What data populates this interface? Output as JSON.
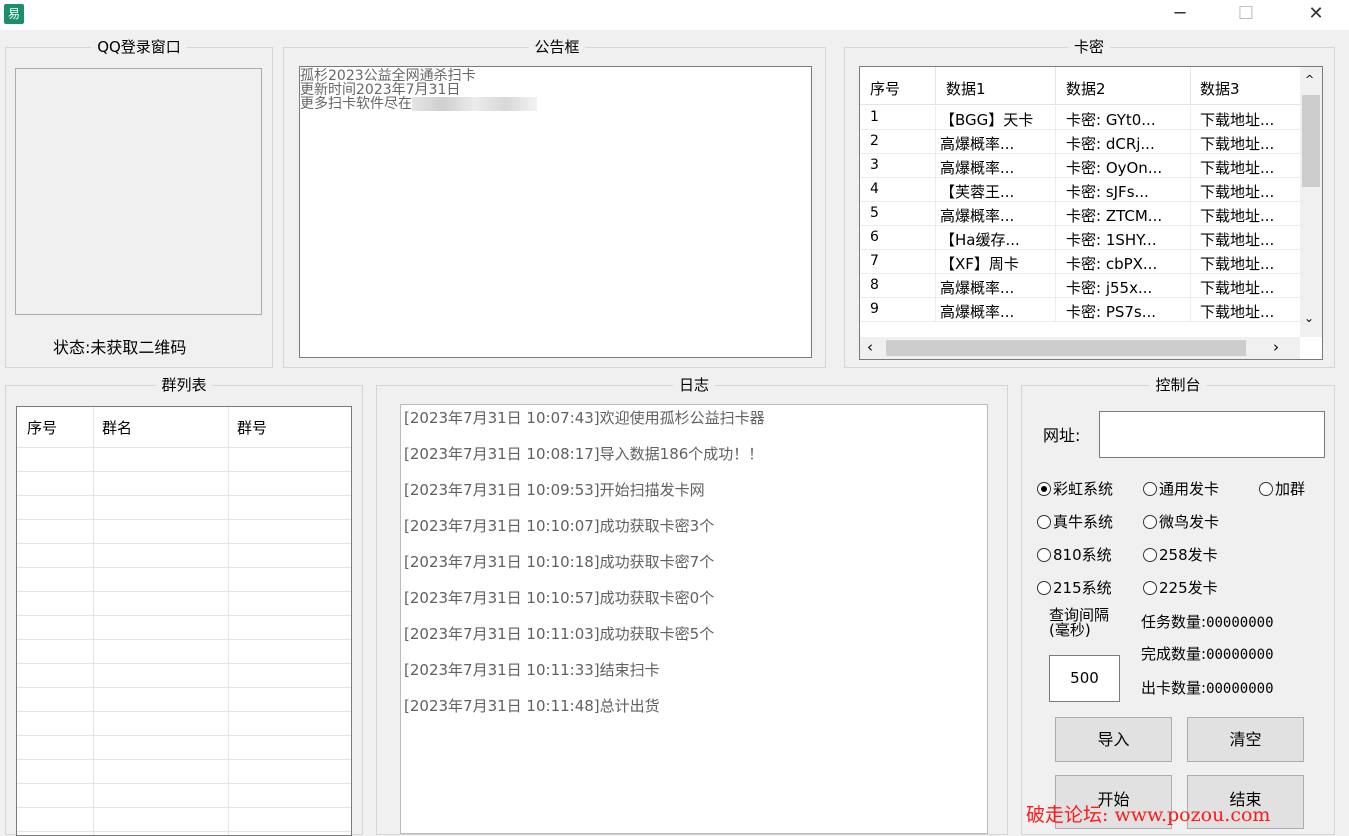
{
  "titlebar": {
    "minimize_icon": "minimize-icon",
    "maximize_icon": "maximize-icon",
    "close_icon": "close-icon"
  },
  "qq_login": {
    "title": "QQ登录窗口",
    "status": "状态:未获取二维码"
  },
  "notice": {
    "title": "公告框",
    "lines": [
      "孤杉2023公益全网通杀扫卡",
      "更新时间2023年7月31日",
      "更多扫卡软件尽在"
    ]
  },
  "cards": {
    "title": "卡密",
    "columns": [
      "序号",
      "数据1",
      "数据2",
      "数据3"
    ],
    "rows": [
      [
        "1",
        "【BGG】天卡",
        "卡密: GYt0...",
        "下载地址..."
      ],
      [
        "2",
        "高爆概率...",
        "卡密: dCRj...",
        "下载地址..."
      ],
      [
        "3",
        "高爆概率...",
        "卡密: OyOn...",
        "下载地址..."
      ],
      [
        "4",
        "【芙蓉王...",
        "卡密: sJFs...",
        "下载地址..."
      ],
      [
        "5",
        "高爆概率...",
        "卡密: ZTCM...",
        "下载地址..."
      ],
      [
        "6",
        "【Ha缓存...",
        "卡密: 1SHY...",
        "下载地址..."
      ],
      [
        "7",
        "【XF】周卡",
        "卡密: cbPX...",
        "下载地址..."
      ],
      [
        "8",
        "高爆概率...",
        "卡密: j55x...",
        "下载地址..."
      ],
      [
        "9",
        "高爆概率...",
        "卡密: PS7s...",
        "下载地址..."
      ]
    ]
  },
  "groups": {
    "title": "群列表",
    "columns": [
      "序号",
      "群名",
      "群号"
    ]
  },
  "log": {
    "title": "日志",
    "lines": [
      "[2023年7月31日 10:07:43]欢迎使用孤杉公益扫卡器",
      "[2023年7月31日 10:08:17]导入数据186个成功！！",
      "[2023年7月31日 10:09:53]开始扫描发卡网",
      "[2023年7月31日 10:10:07]成功获取卡密3个",
      "[2023年7月31日 10:10:18]成功获取卡密7个",
      "[2023年7月31日 10:10:57]成功获取卡密0个",
      "[2023年7月31日 10:11:03]成功获取卡密5个",
      "[2023年7月31日 10:11:33]结束扫卡",
      "[2023年7月31日 10:11:48]总计出货"
    ]
  },
  "console": {
    "title": "控制台",
    "url_label": "网址:",
    "url_value": "",
    "options": [
      {
        "label": "彩虹系统",
        "checked": true
      },
      {
        "label": "通用发卡",
        "checked": false
      },
      {
        "label": "加群",
        "checked": false
      },
      {
        "label": "真牛系统",
        "checked": false
      },
      {
        "label": "微鸟发卡",
        "checked": false
      },
      {
        "label": "810系统",
        "checked": false
      },
      {
        "label": "258发卡",
        "checked": false
      },
      {
        "label": "215系统",
        "checked": false
      },
      {
        "label": "225发卡",
        "checked": false
      }
    ],
    "interval_label_1": "查询间隔",
    "interval_label_2": "(毫秒)",
    "interval_value": "500",
    "task_label": "任务数量:",
    "task_value": "00000000",
    "done_label": "完成数量:",
    "done_value": "00000000",
    "out_label": "出卡数量:",
    "out_value": "00000000",
    "import_label": "导入",
    "clear_label": "清空",
    "start_label": "开始",
    "end_label": "结束"
  },
  "watermark": "破走论坛: www.pozou.com"
}
